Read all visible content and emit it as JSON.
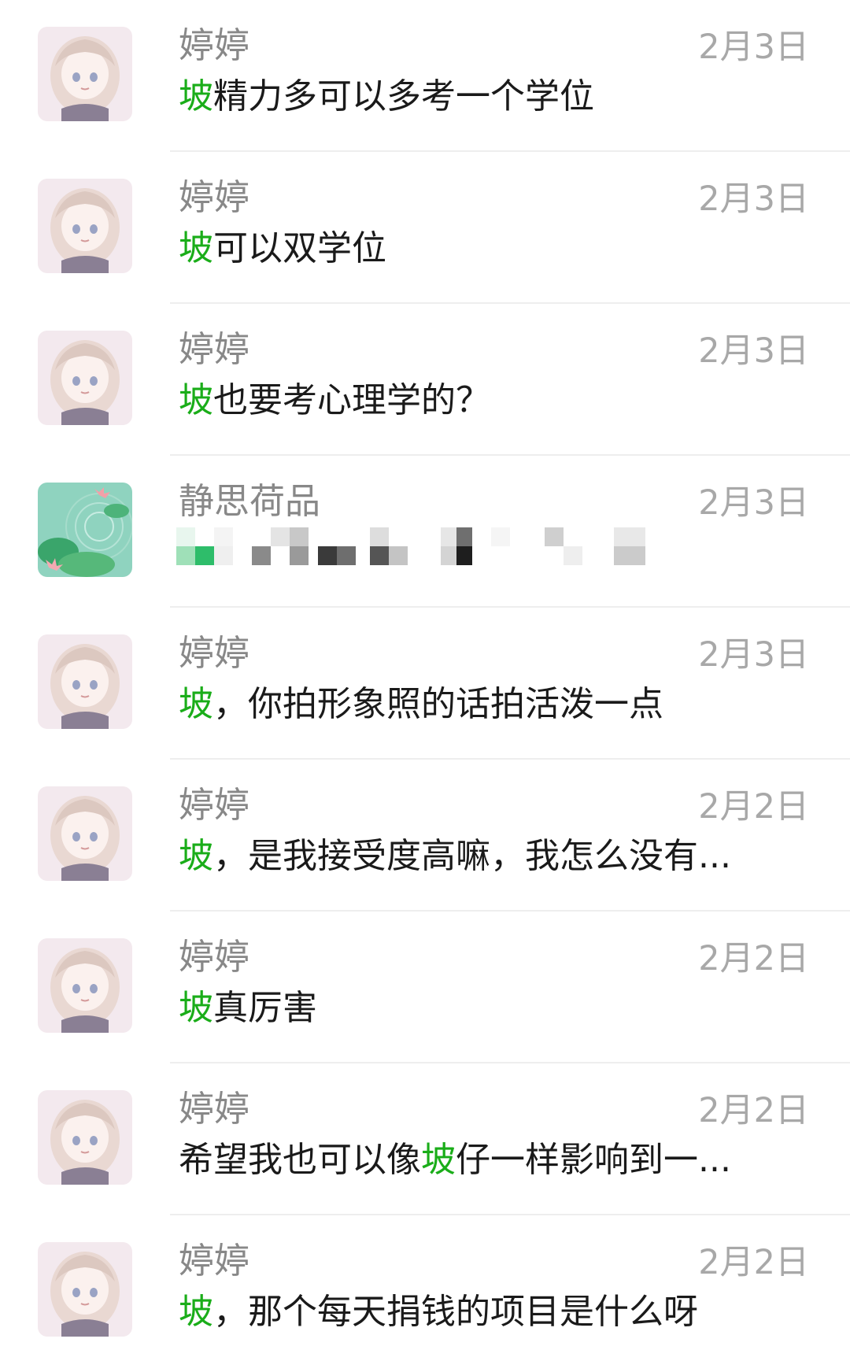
{
  "colors": {
    "keyword": "#1aad19",
    "name": "#888888",
    "date": "#a8a8a8",
    "message": "#1a1a1a",
    "divider": "#eeeeee"
  },
  "rows": [
    {
      "name": "婷婷",
      "date": "2月3日",
      "avatar": "girl-avatar-icon",
      "pre": "",
      "kw": "坡",
      "post": "精力多可以多考一个学位"
    },
    {
      "name": "婷婷",
      "date": "2月3日",
      "avatar": "girl-avatar-icon",
      "pre": "",
      "kw": "坡",
      "post": "可以双学位"
    },
    {
      "name": "婷婷",
      "date": "2月3日",
      "avatar": "girl-avatar-icon",
      "pre": "",
      "kw": "坡",
      "post": "也要考心理学的？"
    },
    {
      "name": "静思荷品",
      "date": "2月3日",
      "avatar": "lotus-pond-avatar-icon",
      "pre": "",
      "kw": "",
      "post": ""
    },
    {
      "name": "婷婷",
      "date": "2月3日",
      "avatar": "girl-avatar-icon",
      "pre": "",
      "kw": "坡",
      "post": "，你拍形象照的话拍活泼一点"
    },
    {
      "name": "婷婷",
      "date": "2月2日",
      "avatar": "girl-avatar-icon",
      "pre": "",
      "kw": "坡",
      "post": "，是我接受度高嘛，我怎么没有..."
    },
    {
      "name": "婷婷",
      "date": "2月2日",
      "avatar": "girl-avatar-icon",
      "pre": "",
      "kw": "坡",
      "post": "真厉害"
    },
    {
      "name": "婷婷",
      "date": "2月2日",
      "avatar": "girl-avatar-icon",
      "pre": "希望我也可以像",
      "kw": "坡",
      "post": "仔一样影响到一..."
    },
    {
      "name": "婷婷",
      "date": "2月2日",
      "avatar": "girl-avatar-icon",
      "pre": "",
      "kw": "坡",
      "post": "，那个每天捐钱的项目是什么呀"
    }
  ]
}
